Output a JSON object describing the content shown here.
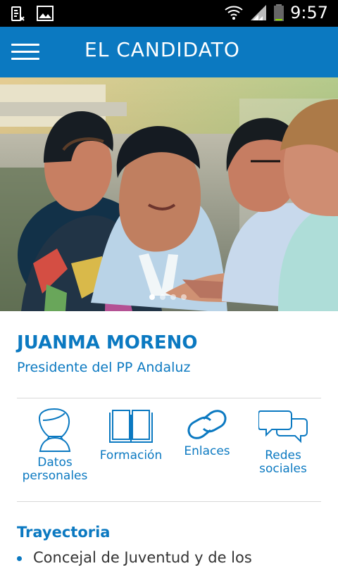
{
  "status_bar": {
    "time": "9:57",
    "icons": [
      "bbm-icon",
      "gallery-icon",
      "wifi-icon",
      "signal-icon",
      "battery-icon"
    ]
  },
  "app_bar": {
    "title": "EL CANDIDATO",
    "menu_icon": "hamburger-icon"
  },
  "carousel": {
    "slide_count": 4,
    "active_index": 0
  },
  "candidate": {
    "name": "JUANMA MORENO",
    "role": "Presidente del PP Andaluz"
  },
  "shortcuts": [
    {
      "label_1": "Datos",
      "label_2": "personales",
      "icon": "person-icon"
    },
    {
      "label_1": "Formación",
      "label_2": "",
      "icon": "book-icon"
    },
    {
      "label_1": "Enlaces",
      "label_2": "",
      "icon": "link-icon"
    },
    {
      "label_1": "Redes",
      "label_2": "sociales",
      "icon": "chat-bubbles-icon"
    }
  ],
  "trajectory": {
    "title": "Trayectoria",
    "items": [
      "Concejal de Juventud y de los"
    ]
  },
  "colors": {
    "brand": "#0b79c1",
    "status_bg": "#000000"
  }
}
